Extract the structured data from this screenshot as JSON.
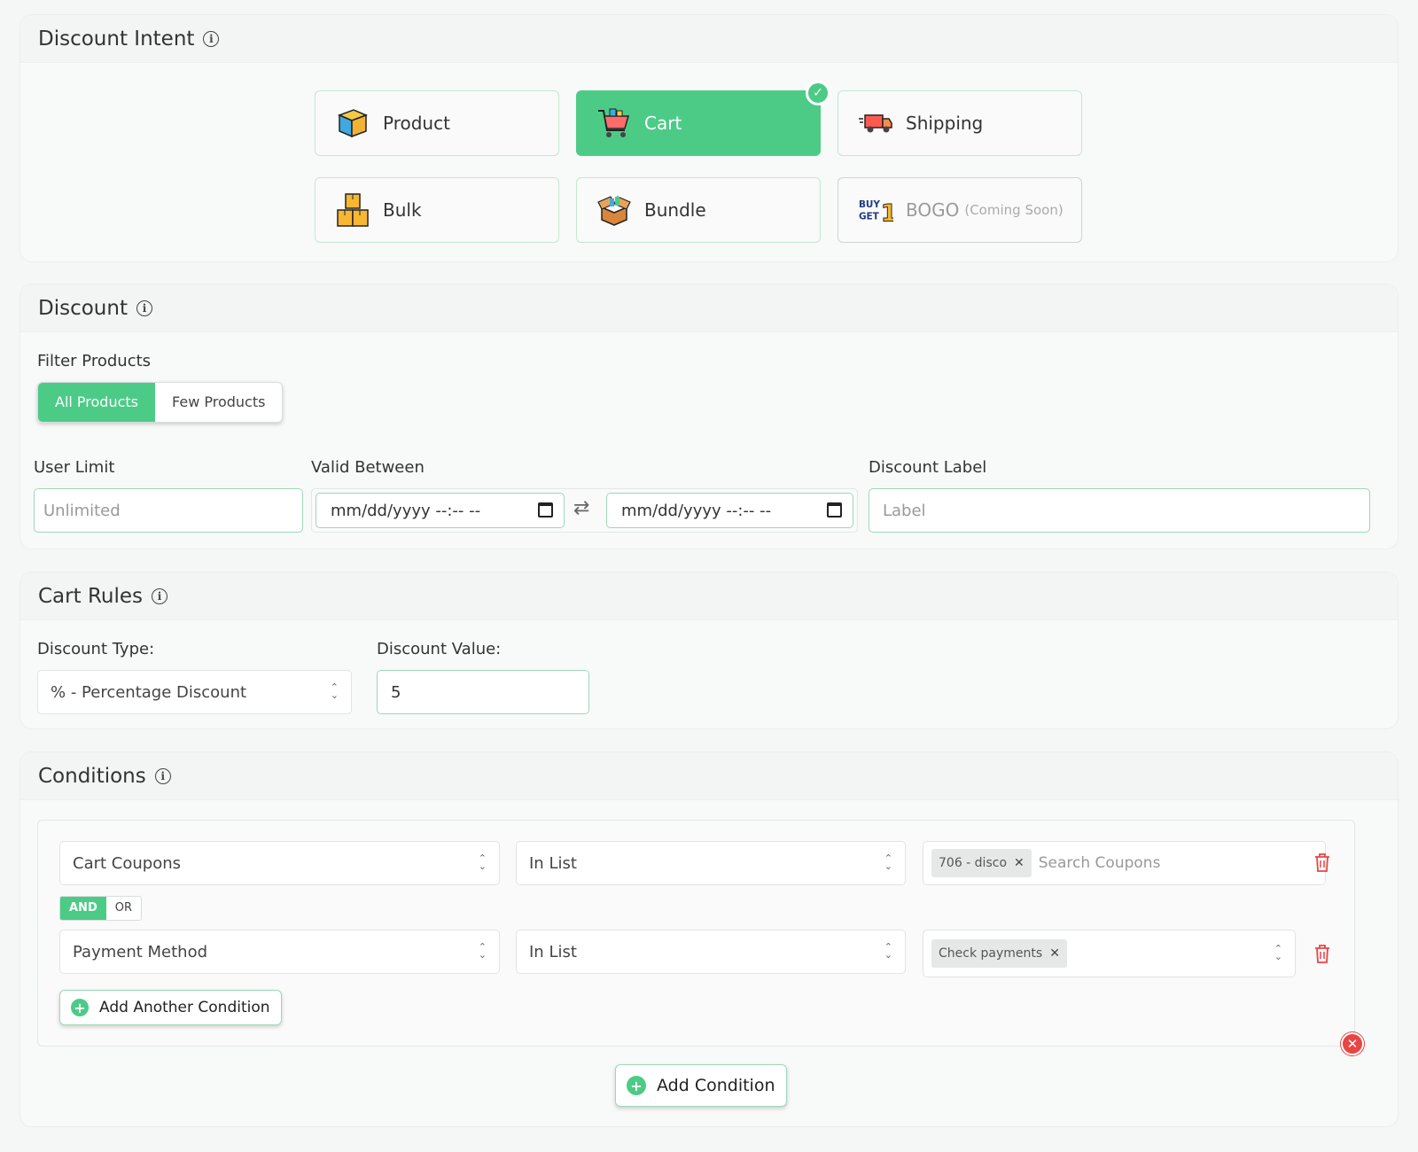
{
  "intent": {
    "title": "Discount Intent",
    "tiles": [
      {
        "label": "Product"
      },
      {
        "label": "Cart"
      },
      {
        "label": "Shipping"
      },
      {
        "label": "Bulk"
      },
      {
        "label": "Bundle"
      },
      {
        "label": "BOGO",
        "note": "(Coming Soon)"
      }
    ],
    "selected": "Cart",
    "bogo_icon_text": "BUY GET 1"
  },
  "discount": {
    "title": "Discount",
    "filter_label": "Filter Products",
    "filter_options": [
      "All Products",
      "Few Products"
    ],
    "filter_selected": "All Products",
    "user_limit_label": "User Limit",
    "user_limit_placeholder": "Unlimited",
    "valid_between_label": "Valid Between",
    "date_start": "mm/dd/yyyy --:-- --",
    "date_end": "mm/dd/yyyy --:-- --",
    "swap_icon": "⇄",
    "label_label": "Discount Label",
    "label_placeholder": "Label"
  },
  "cart_rules": {
    "title": "Cart Rules",
    "type_label": "Discount Type:",
    "type_value": "% - Percentage Discount",
    "value_label": "Discount Value:",
    "value": "5"
  },
  "conditions": {
    "title": "Conditions",
    "rows": [
      {
        "field": "Cart Coupons",
        "operator": "In List",
        "tags": [
          "706 - disco"
        ],
        "search_placeholder": "Search Coupons"
      },
      {
        "field": "Payment Method",
        "operator": "In List",
        "tags": [
          "Check payments"
        ]
      }
    ],
    "and_label": "AND",
    "or_label": "OR",
    "add_another": "Add Another Condition",
    "add_condition": "Add Condition"
  },
  "colors": {
    "accent": "#4ccb87",
    "danger": "#e84545"
  }
}
